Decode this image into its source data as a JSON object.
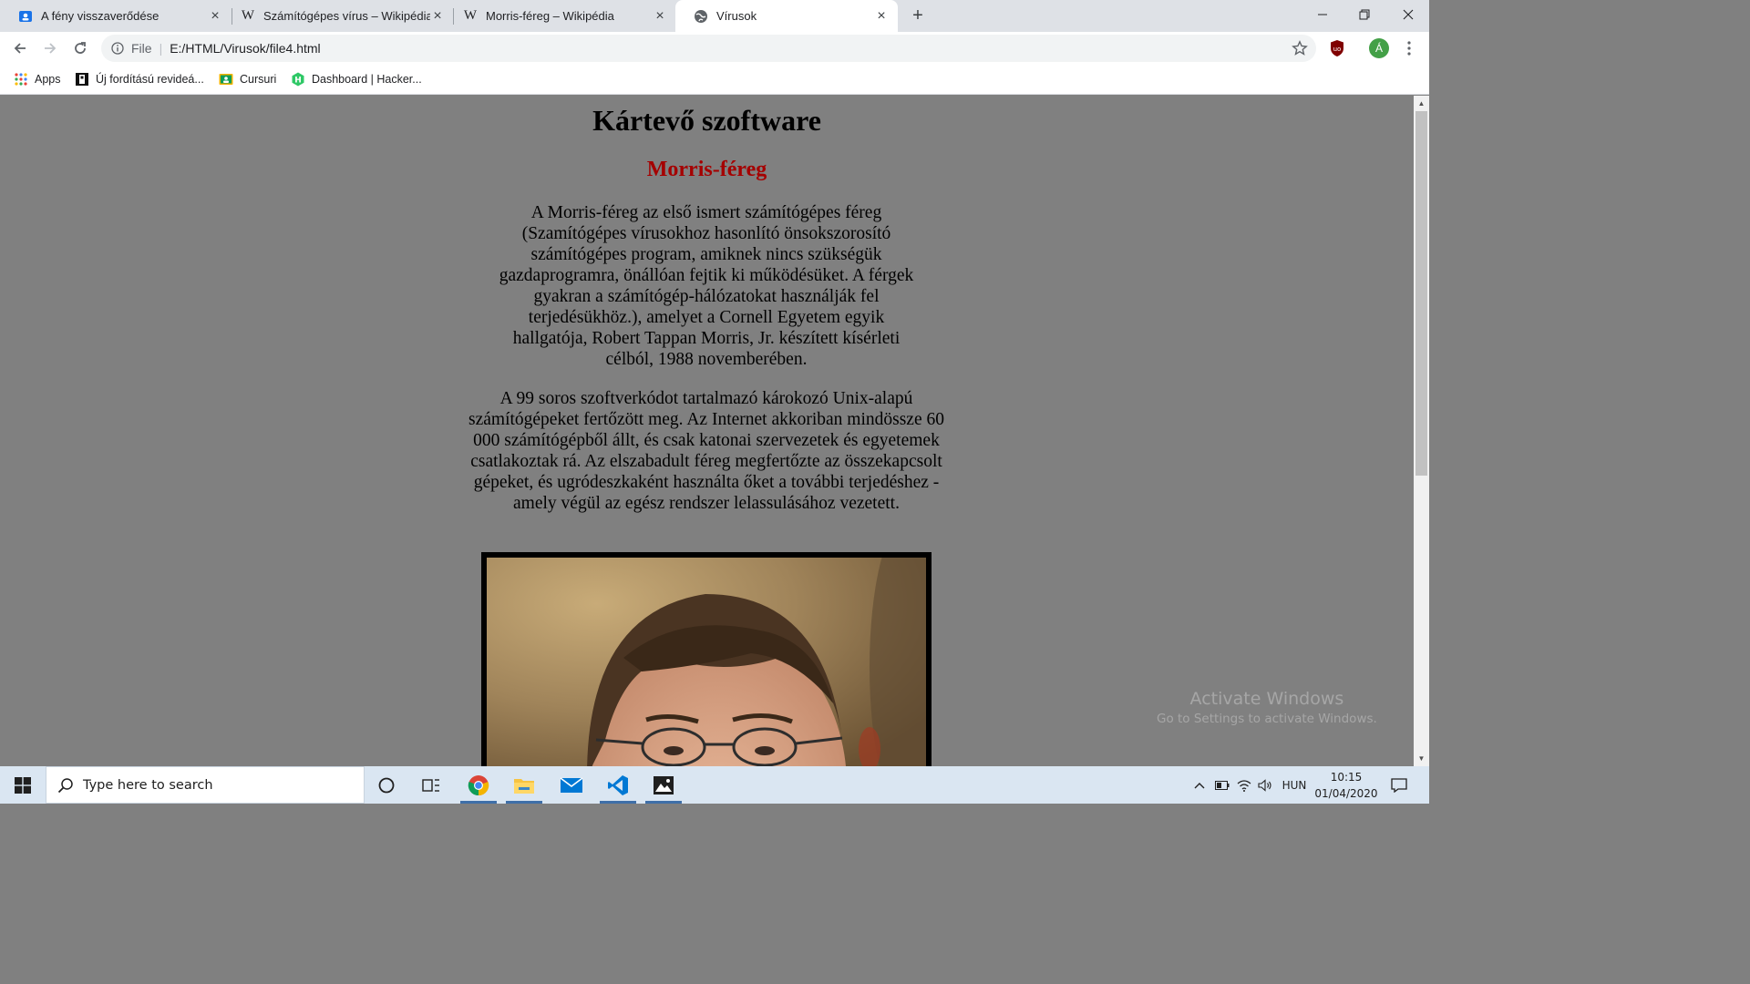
{
  "browser": {
    "tabs": [
      {
        "title": "A fény visszaverődése",
        "favicon": "classroom-icon",
        "active": false
      },
      {
        "title": "Számítógépes vírus – Wikipédia",
        "favicon": "wikipedia-icon",
        "active": false
      },
      {
        "title": "Morris-féreg – Wikipédia",
        "favicon": "wikipedia-icon",
        "active": false
      },
      {
        "title": "Vírusok",
        "favicon": "globe-icon",
        "active": true
      }
    ],
    "address": {
      "scheme": "File",
      "separator": "|",
      "url": "E:/HTML/Virusok/file4.html"
    },
    "profile_initial": "Á",
    "bookmarks": [
      {
        "label": "Apps",
        "icon": "apps-grid-icon"
      },
      {
        "label": "Új fordítású revideá...",
        "icon": "bible-icon"
      },
      {
        "label": "Cursuri",
        "icon": "classroom-icon"
      },
      {
        "label": "Dashboard | Hacker...",
        "icon": "hackerrank-icon"
      }
    ]
  },
  "page": {
    "heading": "Kártevő szoftware",
    "subheading": "Morris-féreg",
    "paragraph1": "A Morris-féreg az első ismert számítógépes féreg (Szamítógépes vírusokhoz hasonlító önsokszorosító számítógépes program, amiknek nincs szükségük gazdaprogramra, önállóan fejtik ki működésüket. A férgek gyakran a számítógép-hálózatokat használják fel terjedésükhöz.), amelyet a Cornell Egyetem egyik hallgatója, Robert Tappan Morris, Jr. készített kísérleti célból, 1988 novemberében.",
    "paragraph2": "A 99 soros szoftverkódot tartalmazó károkozó Unix-alapú számítógépeket fertőzött meg. Az Internet akkoriban mindössze 60 000 számítógépből állt, és csak katonai szervezetek és egyetemek csatlakoztak rá. Az elszabadult féreg megfertőzte az összekapcsolt gépeket, és ugródeszkaként használta őket a további terjedéshez - amely végül az egész rendszer lelassulásához vezetett.",
    "heading_color": "#000000",
    "subheading_color": "#a50000",
    "background_color": "#808080"
  },
  "watermark": {
    "line1": "Activate Windows",
    "line2": "Go to Settings to activate Windows."
  },
  "taskbar": {
    "search_placeholder": "Type here to search",
    "apps": [
      "chrome-icon",
      "file-explorer-icon",
      "mail-icon",
      "vscode-icon",
      "photos-icon"
    ],
    "language": "HUN",
    "time": "10:15",
    "date": "01/04/2020"
  }
}
